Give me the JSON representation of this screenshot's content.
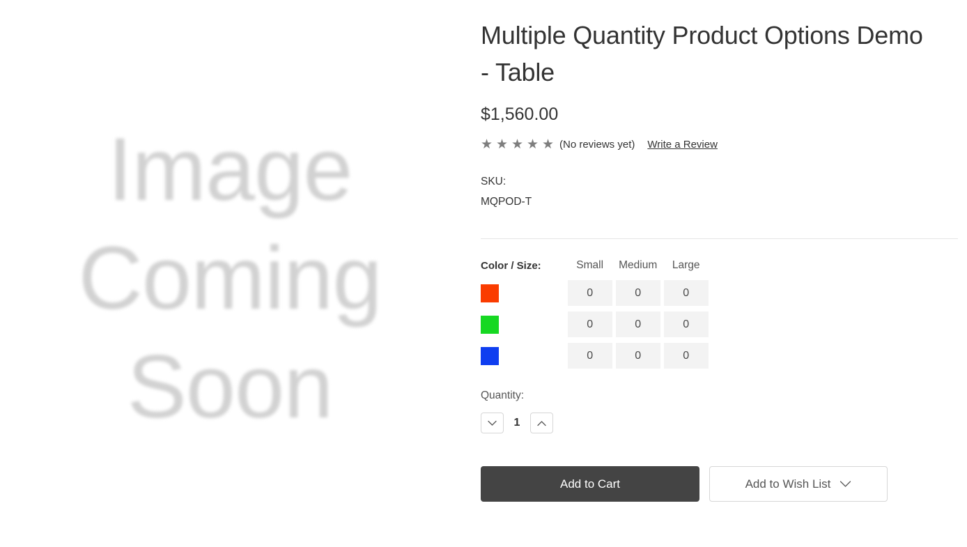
{
  "gallery": {
    "placeholder_text": "Image Coming Soon"
  },
  "product": {
    "title": "Multiple Quantity Product Options Demo - Table",
    "price": "$1,560.00",
    "rating": {
      "stars": [
        "★",
        "★",
        "★",
        "★",
        "★"
      ],
      "star_count": 5,
      "star_color": "#7e7e7e",
      "review_text": "(No reviews yet)",
      "write_review_label": "Write a Review"
    },
    "sku": {
      "label": "SKU:",
      "value": "MQPOD-T"
    }
  },
  "options": {
    "matrix_label": "Color / Size:",
    "size_columns": [
      "Small",
      "Medium",
      "Large"
    ],
    "color_rows": [
      {
        "name": "orange-red",
        "hex": "#fa3c00",
        "quantities": [
          "0",
          "0",
          "0"
        ]
      },
      {
        "name": "green",
        "hex": "#16d822",
        "quantities": [
          "0",
          "0",
          "0"
        ]
      },
      {
        "name": "blue",
        "hex": "#0f3ef0",
        "quantities": [
          "0",
          "0",
          "0"
        ]
      }
    ]
  },
  "quantity": {
    "label": "Quantity:",
    "value": "1",
    "decrement_icon": "chevron-down-icon",
    "increment_icon": "chevron-up-icon"
  },
  "actions": {
    "add_to_cart_label": "Add to Cart",
    "wishlist_label": "Add to Wish List",
    "wishlist_icon": "chevron-down-icon",
    "add_to_cart_bg": "#444444"
  }
}
